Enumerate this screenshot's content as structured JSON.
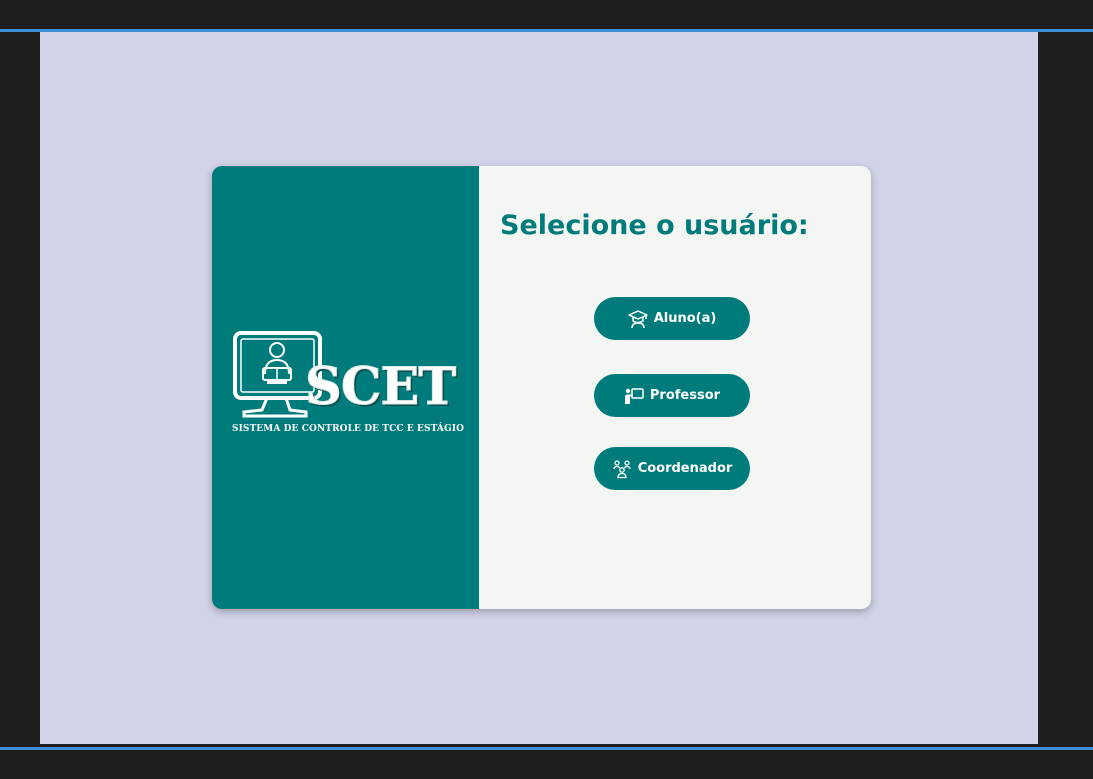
{
  "app": {
    "logo_wordmark": "SCET",
    "logo_tagline": "SISTEMA DE CONTROLE DE TCC  E ESTÁGIO"
  },
  "selection": {
    "title": "Selecione o usuário:",
    "buttons": [
      {
        "label": "Aluno(a)",
        "icon": "graduation-cap-icon"
      },
      {
        "label": "Professor",
        "icon": "teacher-board-icon"
      },
      {
        "label": "Coordenador",
        "icon": "group-icon"
      }
    ]
  },
  "colors": {
    "accent": "#007b7b",
    "panel_bg": "#f3f6f2",
    "page_bg": "#d1d3e6",
    "frame_line": "#3b8fd9"
  }
}
